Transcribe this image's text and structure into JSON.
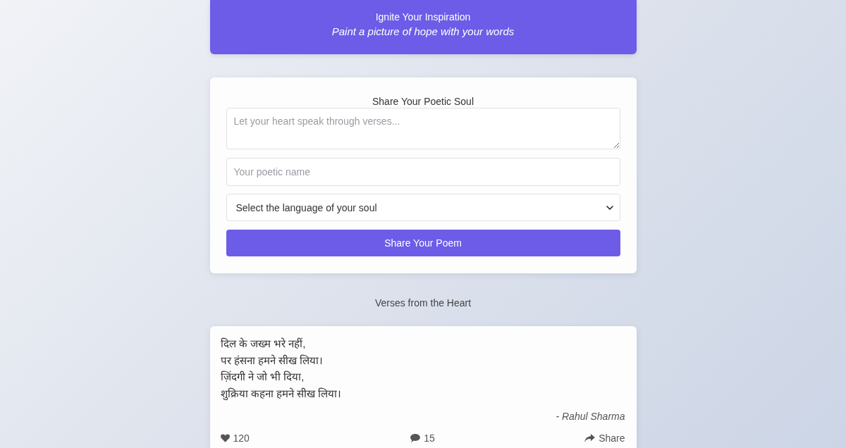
{
  "header": {
    "title": "Ignite Your Inspiration",
    "subtitle": "Paint a picture of hope with your words"
  },
  "form": {
    "title": "Share Your Poetic Soul",
    "poem_field": {
      "placeholder": "Let your heart speak through verses..."
    },
    "name_field": {
      "placeholder": "Your poetic name"
    },
    "language_select": {
      "value": "Select the language of your soul"
    },
    "submit_button": "Share Your Poem"
  },
  "feed": {
    "title": "Verses from the Heart",
    "poems": [
      {
        "lines": [
          "दिल के जख्म भरे नहीं,",
          "पर हंसना हमने सीख लिया।",
          "ज़िंदगी ने जो भी दिया,",
          "शुक्रिया कहना हमने सीख लिया।"
        ],
        "author": "- Rahul Sharma",
        "actions": [
          {
            "kind": "like",
            "label": "120"
          },
          {
            "kind": "comment",
            "label": "15"
          },
          {
            "kind": "share",
            "label": "Share"
          }
        ]
      }
    ]
  }
}
